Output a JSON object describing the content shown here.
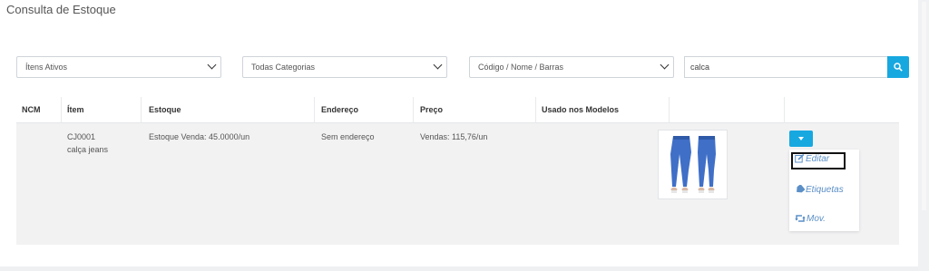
{
  "page": {
    "title": "Consulta de Estoque"
  },
  "filters": {
    "status": "Ítens Ativos",
    "category": "Todas Categorias",
    "search_by": "Código / Nome / Barras",
    "search_value": "calca"
  },
  "table": {
    "headers": [
      "NCM",
      "Ítem",
      "Estoque",
      "Endereço",
      "Preço",
      "Usado nos Modelos"
    ],
    "row": {
      "ncm": "",
      "code": "CJ0001",
      "name": "calça jeans",
      "stock": "Estoque Venda: 45.0000/un",
      "address": "Sem endereço",
      "price": "Vendas: 115,76/un",
      "models": ""
    }
  },
  "actions": {
    "edit": "Editar",
    "labels": "Etiquetas",
    "movements": "Mov."
  },
  "colors": {
    "accent": "#17a8e0",
    "link": "#5b8fc7",
    "row_bg": "#f2f2f3"
  }
}
